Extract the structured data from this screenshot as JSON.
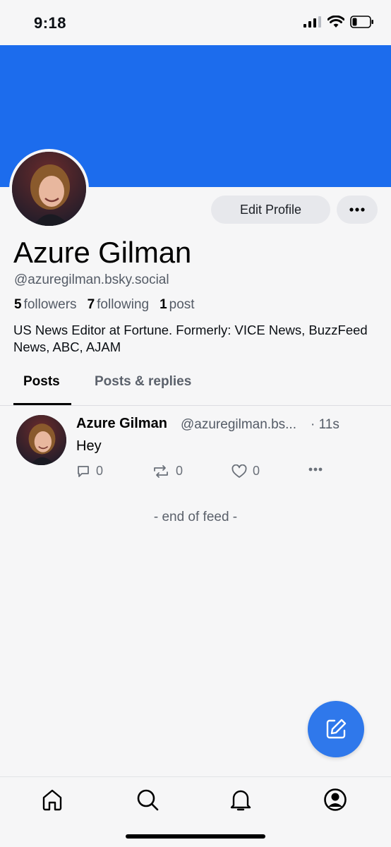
{
  "status_bar": {
    "time": "9:18"
  },
  "profile": {
    "display_name": "Azure Gilman",
    "handle": "@azuregilman.bsky.social",
    "followers_count": "5",
    "followers_label": "followers",
    "following_count": "7",
    "following_label": "following",
    "posts_count": "1",
    "posts_label": "post",
    "bio": "US News Editor at Fortune. Formerly: VICE News, BuzzFeed News, ABC, AJAM",
    "banner_color": "#1c6ced"
  },
  "actions": {
    "edit_profile_label": "Edit Profile",
    "more_icon": "more-horizontal-icon"
  },
  "tabs": [
    {
      "label": "Posts",
      "active": true
    },
    {
      "label": "Posts & replies",
      "active": false
    }
  ],
  "post": {
    "author": "Azure Gilman",
    "handle": "@azuregilman.bs...",
    "time": "· 11s",
    "text": "Hey",
    "reply_count": "0",
    "repost_count": "0",
    "like_count": "0"
  },
  "feed": {
    "end_label": "- end of feed -"
  },
  "nav": {
    "items": [
      "home-icon",
      "search-icon",
      "notifications-icon",
      "profile-icon"
    ]
  },
  "colors": {
    "accent": "#2f78eb",
    "background": "#f6f6f7"
  }
}
